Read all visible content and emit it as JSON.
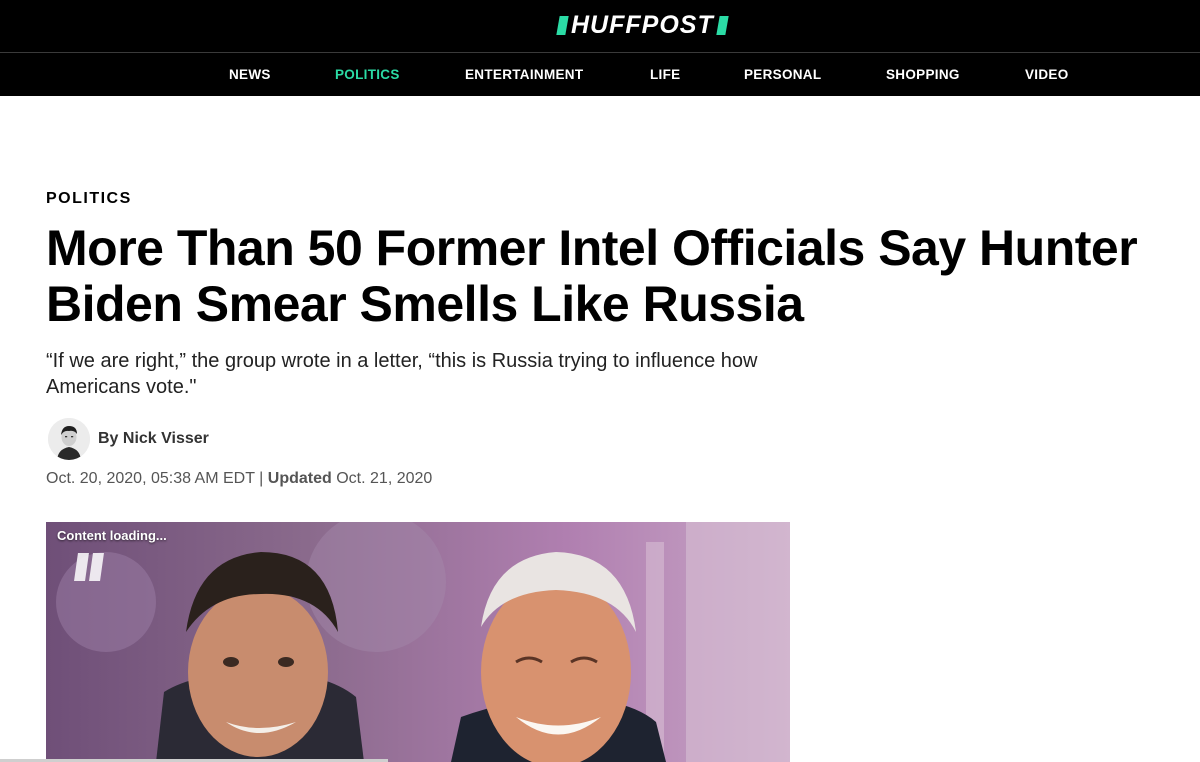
{
  "brand": {
    "logo_text": "HUFFPOST",
    "accent": "#2bdba5"
  },
  "nav": {
    "items": [
      {
        "label": "NEWS"
      },
      {
        "label": "POLITICS",
        "active": true
      },
      {
        "label": "ENTERTAINMENT"
      },
      {
        "label": "LIFE"
      },
      {
        "label": "PERSONAL"
      },
      {
        "label": "SHOPPING"
      },
      {
        "label": "VIDEO"
      }
    ]
  },
  "article": {
    "section": "POLITICS",
    "headline": "More Than 50 Former Intel Officials Say Hunter Biden Smear Smells Like Russia",
    "dek": "“If we are right,” the group wrote in a letter, “this is Russia trying to influence how Americans vote.\"",
    "author": {
      "prefix": "By",
      "name": "Nick Visser"
    },
    "published": "Oct. 20, 2020, 05:38 AM EDT",
    "separator": "|",
    "updated_label": "Updated",
    "updated": "Oct. 21, 2020"
  },
  "media": {
    "status_text": "Content loading..."
  }
}
